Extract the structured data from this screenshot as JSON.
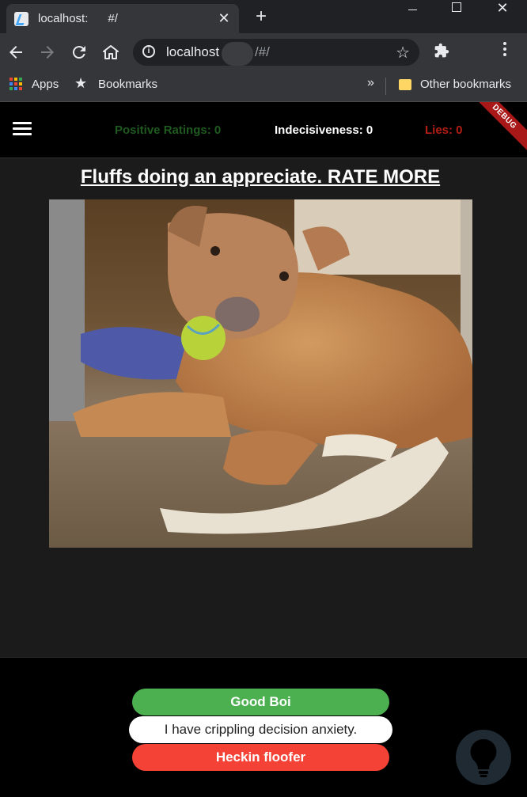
{
  "browser": {
    "tab_title": "localhost:      #/",
    "tab_close": "✕",
    "new_tab": "+",
    "url_host": "localhost",
    "url_path": "/#/",
    "bookmarks": {
      "apps_label": "Apps",
      "bookmarks_label": "Bookmarks",
      "more": "»",
      "other_label": "Other bookmarks"
    }
  },
  "app": {
    "stats": {
      "positive": "Positive Ratings: 0",
      "indecisiveness": "Indecisiveness: 0",
      "lies": "Lies: 0"
    },
    "debug_banner": "DEBUG",
    "headline": "Fluffs doing an appreciate. RATE MORE",
    "buttons": {
      "good": "Good Boi",
      "anxiety": "I have crippling decision anxiety.",
      "floofer": "Heckin floofer"
    }
  },
  "colors": {
    "positive": "#1f5a20",
    "lies": "#b41e14",
    "good_button": "#4caf50",
    "floofer_button": "#f44336",
    "debug": "#a81818"
  },
  "icons": [
    "flutter-favicon-icon",
    "close-icon",
    "plus-icon",
    "minimize-icon",
    "maximize-icon",
    "back-icon",
    "forward-icon",
    "reload-icon",
    "home-icon",
    "info-icon",
    "star-icon",
    "extension-icon",
    "kebab-menu-icon",
    "apps-grid-icon",
    "folder-icon",
    "hamburger-icon",
    "lightbulb-icon"
  ]
}
